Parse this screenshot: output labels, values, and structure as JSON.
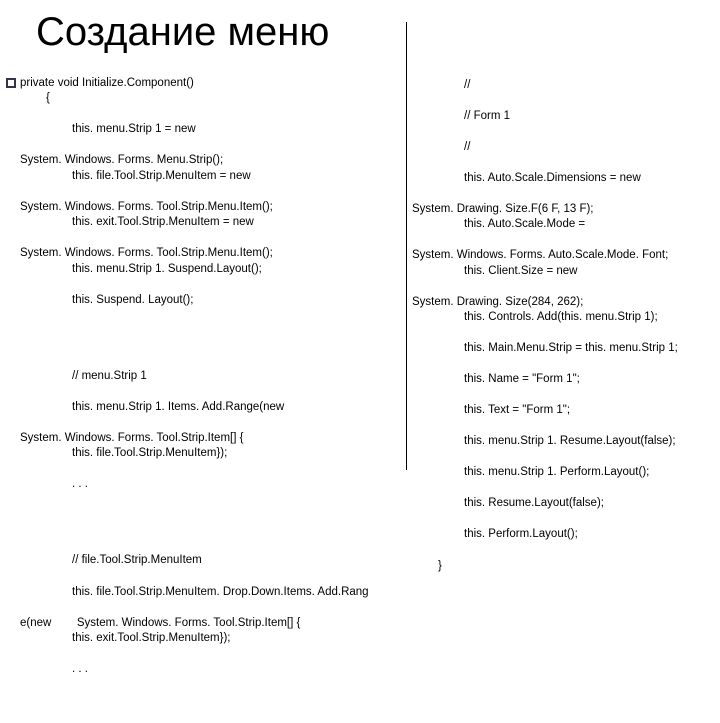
{
  "title": "Создание меню",
  "left": {
    "b1_l1": "private void Initialize.Component()",
    "b1_l2": "{",
    "b1_l3": "this. menu.Strip 1 = new",
    "b1_l4": "System. Windows. Forms. Menu.Strip();",
    "b1_l5": "this. file.Tool.Strip.MenuItem = new",
    "b1_l6": "System. Windows. Forms. Tool.Strip.Menu.Item();",
    "b1_l7": "this. exit.Tool.Strip.MenuItem = new",
    "b1_l8": "System. Windows. Forms. Tool.Strip.Menu.Item();",
    "b1_l9": "this. menu.Strip 1. Suspend.Layout();",
    "b1_l10": "this. Suspend. Layout();",
    "b2_l1": "// menu.Strip 1",
    "b2_l2": "this. menu.Strip 1. Items. Add.Range(new",
    "b2_l3": "System. Windows. Forms. Tool.Strip.Item[] {",
    "b2_l4": "this. file.Tool.Strip.MenuItem});",
    "b2_l5": ". . .",
    "b3_l1": "// file.Tool.Strip.MenuItem",
    "b3_l2": "this. file.Tool.Strip.MenuItem. Drop.Down.Items. Add.Rang",
    "b3_l3a": "e(new",
    "b3_l3b": "System. Windows. Forms. Tool.Strip.Item[] {",
    "b3_l4": "this. exit.Tool.Strip.MenuItem});",
    "b3_l5": ". . ."
  },
  "right": {
    "l1": "//",
    "l2": "// Form 1",
    "l3": "//",
    "l4": "this. Auto.Scale.Dimensions = new",
    "l5": "System. Drawing. Size.F(6 F, 13 F);",
    "l6": "this. Auto.Scale.Mode =",
    "l7": "System. Windows. Forms. Auto.Scale.Mode. Font;",
    "l8": "this. Client.Size = new",
    "l9": "System. Drawing. Size(284, 262);",
    "l10": "this. Controls. Add(this. menu.Strip 1);",
    "l11": "this. Main.Menu.Strip = this. menu.Strip 1;",
    "l12": "this. Name = \"Form 1\";",
    "l13": "this. Text = \"Form 1\";",
    "l14": "this. menu.Strip 1. Resume.Layout(false);",
    "l15": "this. menu.Strip 1. Perform.Layout();",
    "l16": "this. Resume.Layout(false);",
    "l17": "this. Perform.Layout();",
    "l18": "}"
  }
}
